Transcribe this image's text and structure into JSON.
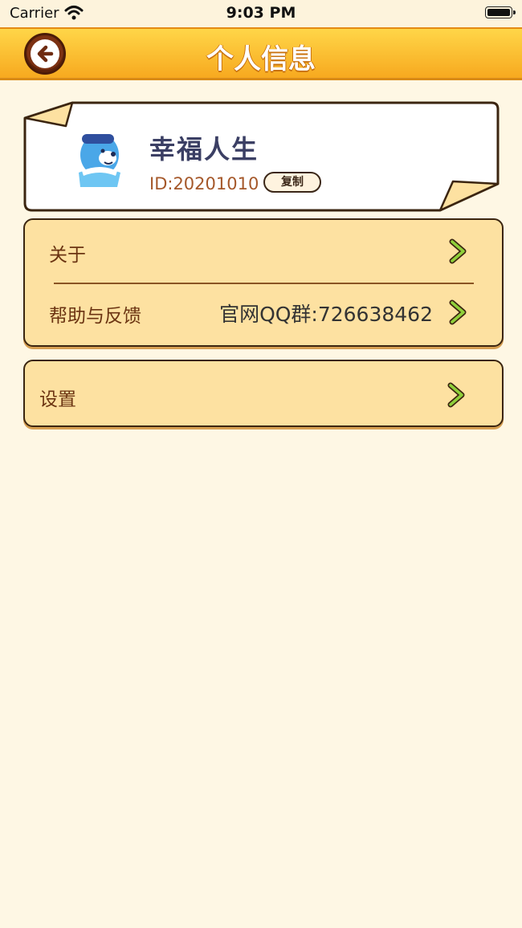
{
  "status_bar": {
    "carrier": "Carrier",
    "time": "9:03 PM"
  },
  "nav": {
    "title": "个人信息",
    "back_icon": "back-arrow-icon"
  },
  "profile": {
    "name": "幸福人生",
    "id_text": "ID:20201010",
    "copy_label": "复制",
    "avatar_icon": "bear-avatar-icon"
  },
  "menu": {
    "about_label": "关于",
    "help_label": "帮助与反馈",
    "help_value": "官网QQ群:726638462",
    "settings_label": "设置"
  },
  "colors": {
    "background": "#fef7e4",
    "header_gradient_top": "#ffd648",
    "header_gradient_bottom": "#f7a91f",
    "card_fill": "#fde1a1",
    "border": "#3b2510",
    "label_text": "#6b3412",
    "chevron_green": "#8fd03a"
  }
}
